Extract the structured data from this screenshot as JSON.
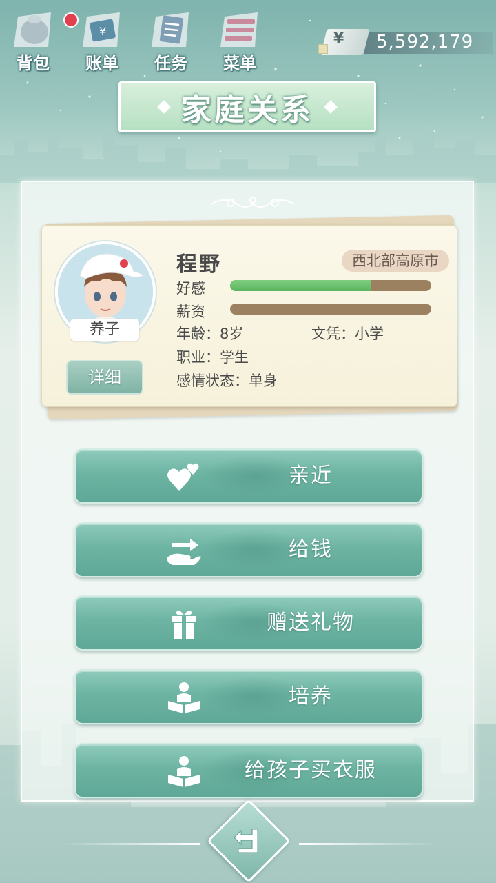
{
  "topbar": {
    "items": [
      {
        "label": "背包",
        "icon": "bag-icon",
        "has_notification": true
      },
      {
        "label": "账单",
        "icon": "bill-icon"
      },
      {
        "label": "任务",
        "icon": "task-icon"
      },
      {
        "label": "菜单",
        "icon": "menu-icon"
      }
    ],
    "currency_symbol": "¥",
    "money": "5,592,179"
  },
  "title": "家庭关系",
  "character": {
    "name": "程野",
    "region": "西北部高原市",
    "relation": "养子",
    "detail_label": "详细",
    "favor_label": "好感",
    "favor_level": 0.7,
    "salary_label": "薪资",
    "salary_level": 0,
    "age_text": "年龄：8岁",
    "education_text": "文凭：小学",
    "job_text": "职业：学生",
    "relationship_text": "感情状态：单身"
  },
  "actions": [
    {
      "label": "亲近",
      "icon": "hearts-icon"
    },
    {
      "label": "给钱",
      "icon": "give-money-icon"
    },
    {
      "label": "赠送礼物",
      "icon": "gift-icon"
    },
    {
      "label": "培养",
      "icon": "reading-icon"
    },
    {
      "label": "给孩子买衣服",
      "icon": "reading-icon"
    }
  ],
  "back_icon": "back-arrow-icon",
  "colors": {
    "button_teal": "#6db4a3",
    "favor_green": "#5bb45f",
    "bar_brown": "#9c8160",
    "notification_red": "#e2404f"
  }
}
